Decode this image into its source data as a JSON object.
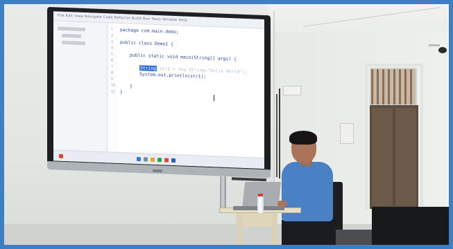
{
  "scene": {
    "description_free": true,
    "accent_colors": {
      "border": "#3d7fc1",
      "shirt": "#4a80c4",
      "highlight": "#2f6fd6",
      "bottle_cap": "#d93a2b"
    }
  },
  "screen": {
    "ide_menu": "File  Edit  View  Navigate  Code  Refactor  Build  Run  Tools  Window  Help",
    "code_lines": [
      {
        "n": "1",
        "text": "package com.main.demo;"
      },
      {
        "n": "2",
        "text": ""
      },
      {
        "n": "3",
        "text": "public class Demo1 {"
      },
      {
        "n": "4",
        "text": ""
      },
      {
        "n": "5",
        "text": "public static void main(String[] args) {"
      },
      {
        "n": "6",
        "text": ""
      },
      {
        "n": "7",
        "text_before": "",
        "highlight": "String",
        "text_after": " str1 = new String(\"Hello World\");"
      },
      {
        "n": "8",
        "text": "System.out.println(str1);"
      },
      {
        "n": "9",
        "text": ""
      },
      {
        "n": "10",
        "text": "}"
      },
      {
        "n": "11",
        "text": "}"
      }
    ]
  }
}
